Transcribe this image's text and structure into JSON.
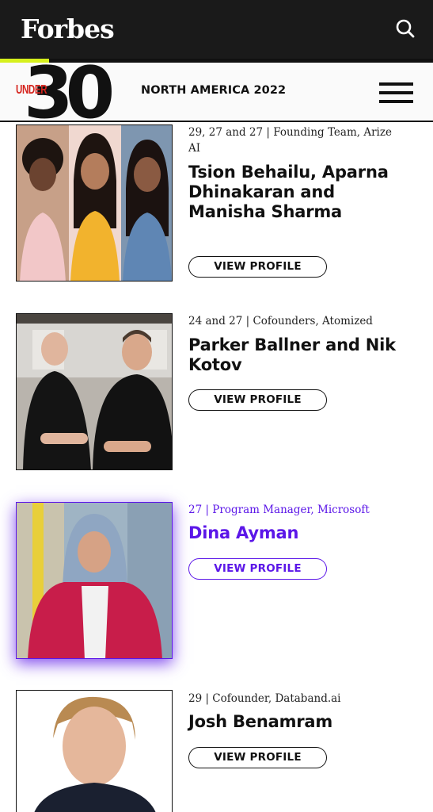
{
  "header": {
    "logo": "Forbes",
    "icons": {
      "search": "search-icon",
      "menu": "menu-icon"
    }
  },
  "subheader": {
    "under": "UNDER",
    "thirty": "30",
    "title": "NORTH AMERICA 2022"
  },
  "colors": {
    "accent": "#d6f01c",
    "highlight": "#5b16e8",
    "under_red": "#d5231c",
    "header_bg": "#1a1a1a"
  },
  "listees": [
    {
      "meta": "29, 27 and 27 | Founding Team, Arize AI",
      "name": "Tsion Behailu, Aparna Dhinakaran and Manisha Sharma",
      "button": "VIEW PROFILE",
      "photo": "founders-trio-photo"
    },
    {
      "meta": "24 and 27 | Cofounders, Atomized",
      "name": "Parker Ballner and Nik Kotov",
      "button": "VIEW PROFILE",
      "photo": "cofounders-duo-photo"
    },
    {
      "meta": "27 | Program Manager, Microsoft",
      "name": "Dina Ayman",
      "button": "VIEW PROFILE",
      "photo": "portrait-photo"
    },
    {
      "meta": "29 | Cofounder, Databand.ai",
      "name": "Josh Benamram",
      "button": "VIEW PROFILE",
      "photo": "portrait-photo"
    }
  ]
}
